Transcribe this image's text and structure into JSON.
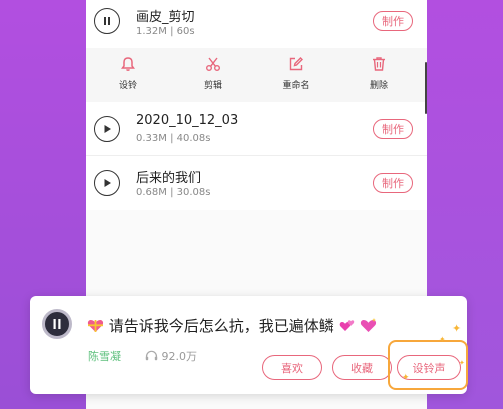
{
  "tracks": [
    {
      "title": "画皮_剪切",
      "meta": "1.32M | 60s",
      "state": "playing",
      "action": "制作"
    },
    {
      "title": "2020_10_12_03",
      "meta": "0.33M | 40.08s",
      "state": "paused",
      "action": "制作"
    },
    {
      "title": "后来的我们",
      "meta": "0.68M | 30.08s",
      "state": "paused",
      "action": "制作"
    }
  ],
  "toolbar": {
    "items": [
      {
        "label": "设铃",
        "icon": "bell-icon"
      },
      {
        "label": "剪辑",
        "icon": "scissors-icon"
      },
      {
        "label": "重命名",
        "icon": "edit-icon"
      },
      {
        "label": "删除",
        "icon": "trash-icon"
      }
    ]
  },
  "popup": {
    "lyric": "请告诉我今后怎么抗，我已遍体鳞",
    "artist": "陈雪凝",
    "plays": "92.0万",
    "buttons": {
      "like": "喜欢",
      "collect": "收藏",
      "set_ringtone": "设铃声"
    }
  },
  "colors": {
    "accent": "#e8677c",
    "purple_bg": "#b24fe0",
    "artist_green": "#5ec07d",
    "highlight_orange": "#f7a73b"
  }
}
